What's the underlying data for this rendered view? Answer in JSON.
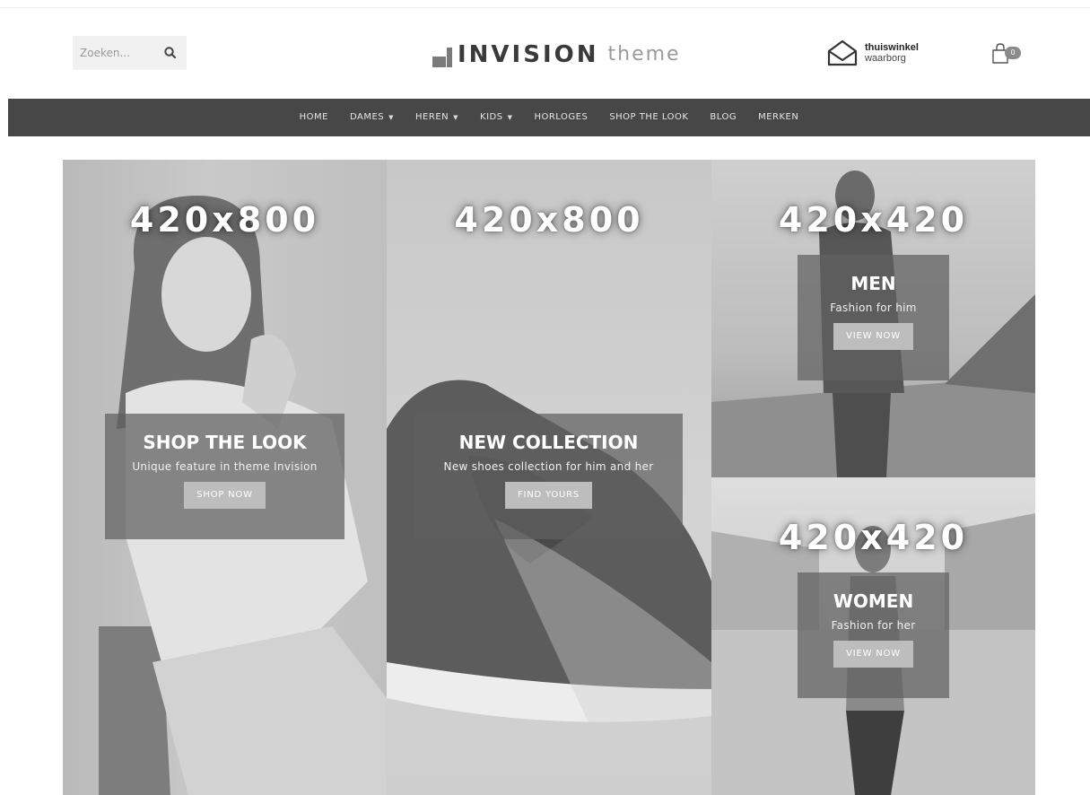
{
  "search": {
    "placeholder": "Zoeken..."
  },
  "logo": {
    "strong": "INVISION",
    "light": "theme"
  },
  "waarborg": {
    "line1": "thuiswinkel",
    "line2": "waarborg"
  },
  "cart": {
    "count": "0"
  },
  "nav": {
    "items": [
      {
        "label": "HOME"
      },
      {
        "label": "DAMES"
      },
      {
        "label": "HEREN"
      },
      {
        "label": "KIDS"
      },
      {
        "label": "HORLOGES"
      },
      {
        "label": "SHOP THE LOOK"
      },
      {
        "label": "BLOG"
      },
      {
        "label": "MERKEN"
      }
    ]
  },
  "banners": [
    {
      "size": "420x800",
      "title": "SHOP THE LOOK",
      "subtitle": "Unique feature in theme Invision",
      "button": "SHOP NOW"
    },
    {
      "size": "420x800",
      "title": "NEW COLLECTION",
      "subtitle": "New shoes collection for him and her",
      "button": "FIND YOURS"
    },
    {
      "size": "420x420",
      "title": "MEN",
      "subtitle": "Fashion for him",
      "button": "VIEW NOW"
    },
    {
      "size": "420x420",
      "title": "WOMEN",
      "subtitle": "Fashion for her",
      "button": "VIEW NOW"
    }
  ],
  "colors": {
    "nav_bg": "#474747",
    "overlay": "#5f5f5f",
    "button": "#bdbdbd"
  }
}
